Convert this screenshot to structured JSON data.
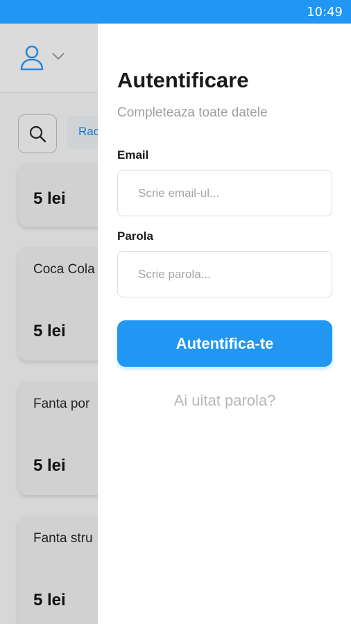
{
  "status_bar": {
    "time": "10:49"
  },
  "background": {
    "header": {
      "user_icon": "user-icon",
      "chevron_icon": "chevron-down-icon"
    },
    "filter_bar": {
      "search_icon": "search-icon",
      "chip_label": "Rac"
    },
    "cards": [
      {
        "name": "",
        "price": "5 lei"
      },
      {
        "name": "Coca Cola",
        "price": "5 lei"
      },
      {
        "name": "Fanta por",
        "price": "5 lei"
      },
      {
        "name": "Fanta stru",
        "price": "5 lei"
      }
    ]
  },
  "drawer": {
    "title": "Autentificare",
    "subtitle": "Completeaza toate datele",
    "email": {
      "label": "Email",
      "placeholder": "Scrie email-ul...",
      "value": ""
    },
    "password": {
      "label": "Parola",
      "placeholder": "Scrie parola...",
      "value": ""
    },
    "login_button": "Autentifica-te",
    "forgot_link": "Ai uitat parola?"
  },
  "colors": {
    "accent": "#2196f3",
    "background_dim": "#d7d7d7",
    "drawer": "#ffffff"
  }
}
